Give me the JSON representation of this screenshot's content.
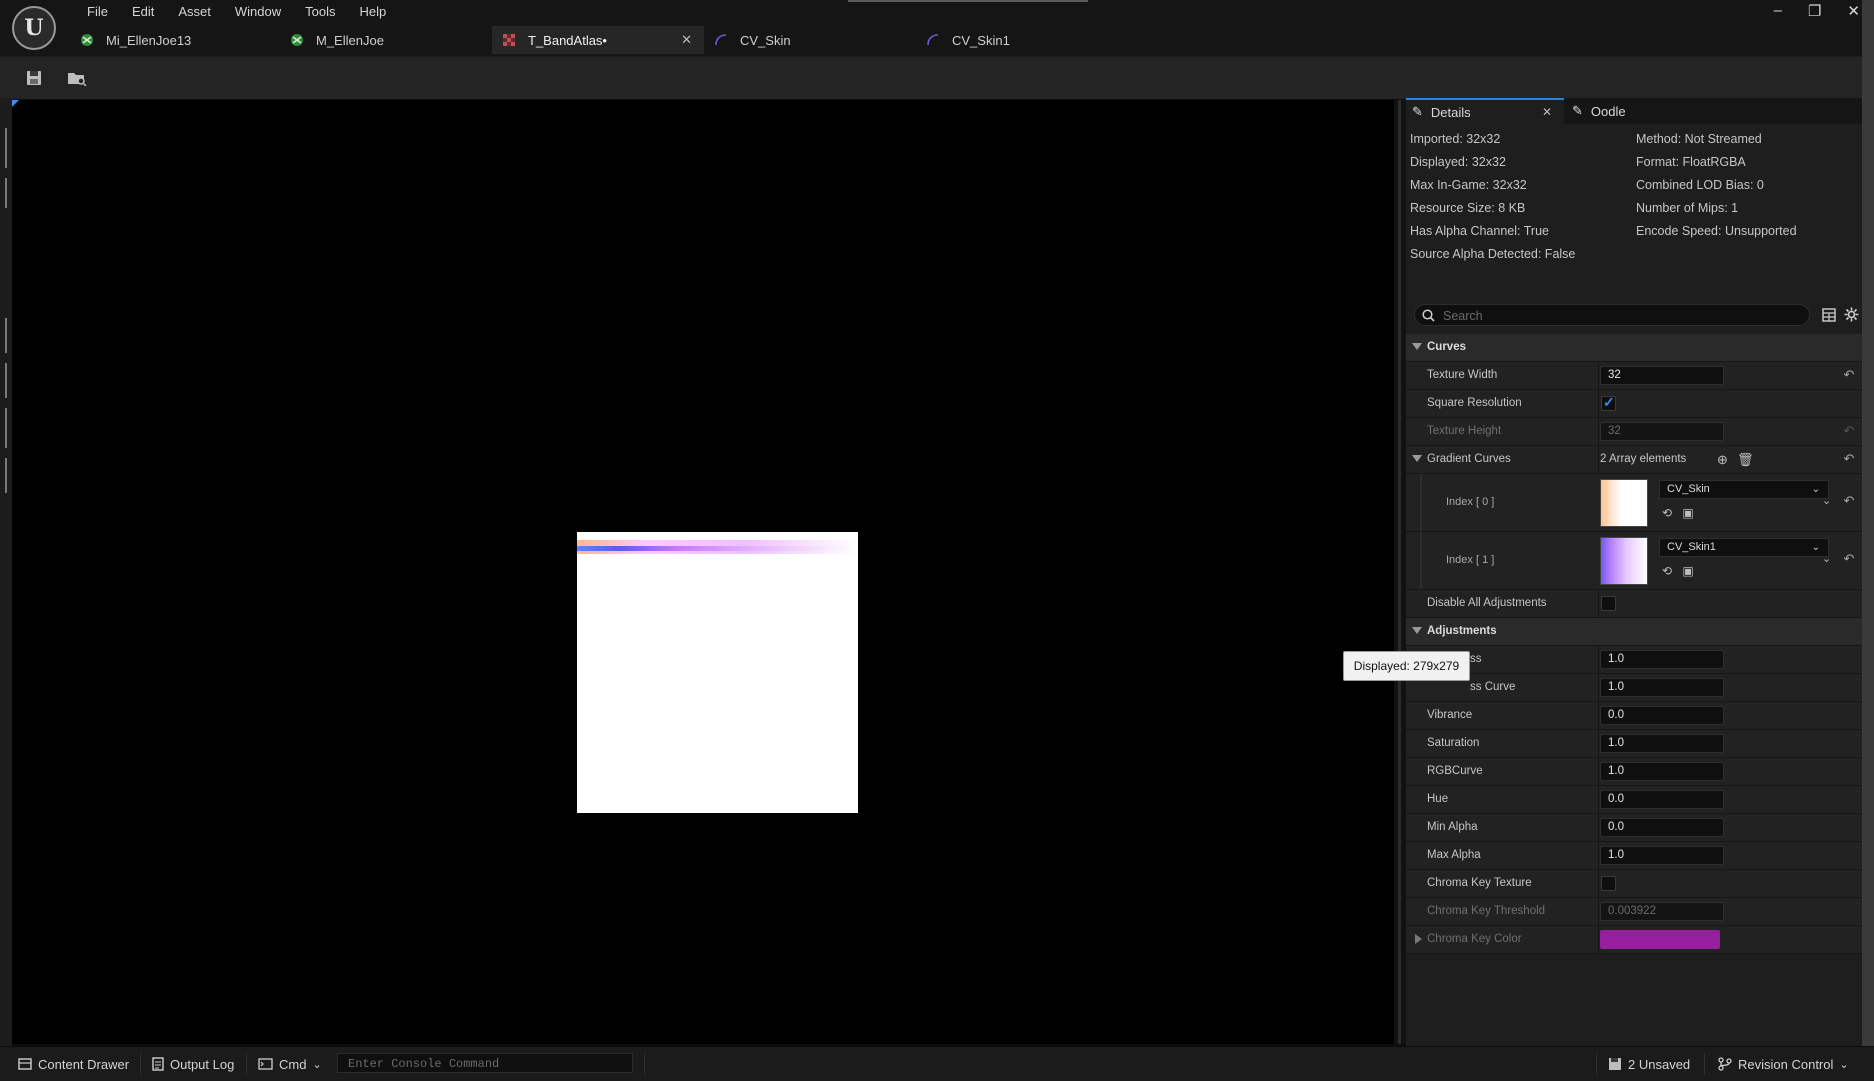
{
  "menu": [
    "File",
    "Edit",
    "Asset",
    "Window",
    "Tools",
    "Help"
  ],
  "tabs": [
    {
      "label": "Mi_EllenJoe13",
      "icon": "material-instance-icon"
    },
    {
      "label": "M_EllenJoe",
      "icon": "material-icon"
    },
    {
      "label": "T_BandAtlas•",
      "icon": "texture-icon"
    },
    {
      "label": "CV_Skin",
      "icon": "curve-icon"
    },
    {
      "label": "CV_Skin1",
      "icon": "curve-icon"
    }
  ],
  "window_controls": {
    "minimize": "–",
    "restore": "❐",
    "close": "✕"
  },
  "details_panel": {
    "tabs": [
      "Details",
      "Oodle"
    ],
    "info_left": [
      "Imported: 32x32",
      "Displayed: 32x32",
      "Max In-Game: 32x32",
      "Resource Size: 8 KB",
      "Has Alpha Channel: True",
      "Source Alpha Detected: False"
    ],
    "info_right": [
      "Method: Not Streamed",
      "Format: FloatRGBA",
      "Combined LOD Bias: 0",
      "Number of Mips: 1",
      "Encode Speed: Unsupported"
    ],
    "search_placeholder": "Search",
    "curves": {
      "section": "Curves",
      "texture_width_label": "Texture Width",
      "texture_width": "32",
      "square_resolution_label": "Square Resolution",
      "texture_height_label": "Texture Height",
      "texture_height": "32",
      "gradient_curves_label": "Gradient Curves",
      "array_count": "2 Array elements",
      "items": [
        {
          "index": "Index [ 0 ]",
          "curve": "CV_Skin"
        },
        {
          "index": "Index [ 1 ]",
          "curve": "CV_Skin1"
        }
      ],
      "disable_adjustments_label": "Disable All Adjustments"
    },
    "adjustments": {
      "section": "Adjustments",
      "rows": [
        {
          "label": "ss",
          "value": "1.0"
        },
        {
          "label": "ss Curve",
          "value": "1.0"
        },
        {
          "label": "Vibrance",
          "value": "0.0"
        },
        {
          "label": "Saturation",
          "value": "1.0"
        },
        {
          "label": "RGBCurve",
          "value": "1.0"
        },
        {
          "label": "Hue",
          "value": "0.0"
        },
        {
          "label": "Min Alpha",
          "value": "0.0"
        },
        {
          "label": "Max Alpha",
          "value": "1.0"
        }
      ],
      "chroma_key_texture_label": "Chroma Key Texture",
      "chroma_key_threshold_label": "Chroma Key Threshold",
      "chroma_key_threshold": "0.003922",
      "chroma_key_color_label": "Chroma Key Color",
      "chroma_key_color": "#951f9d"
    }
  },
  "tooltip": "Displayed: 279x279",
  "statusbar": {
    "content_drawer": "Content Drawer",
    "output_log": "Output Log",
    "cmd": "Cmd",
    "console_placeholder": "Enter Console Command",
    "unsaved": "2 Unsaved",
    "revision_control": "Revision Control"
  },
  "colors": {
    "accent": "#2f7fd8",
    "background": "#1e1e1e"
  }
}
